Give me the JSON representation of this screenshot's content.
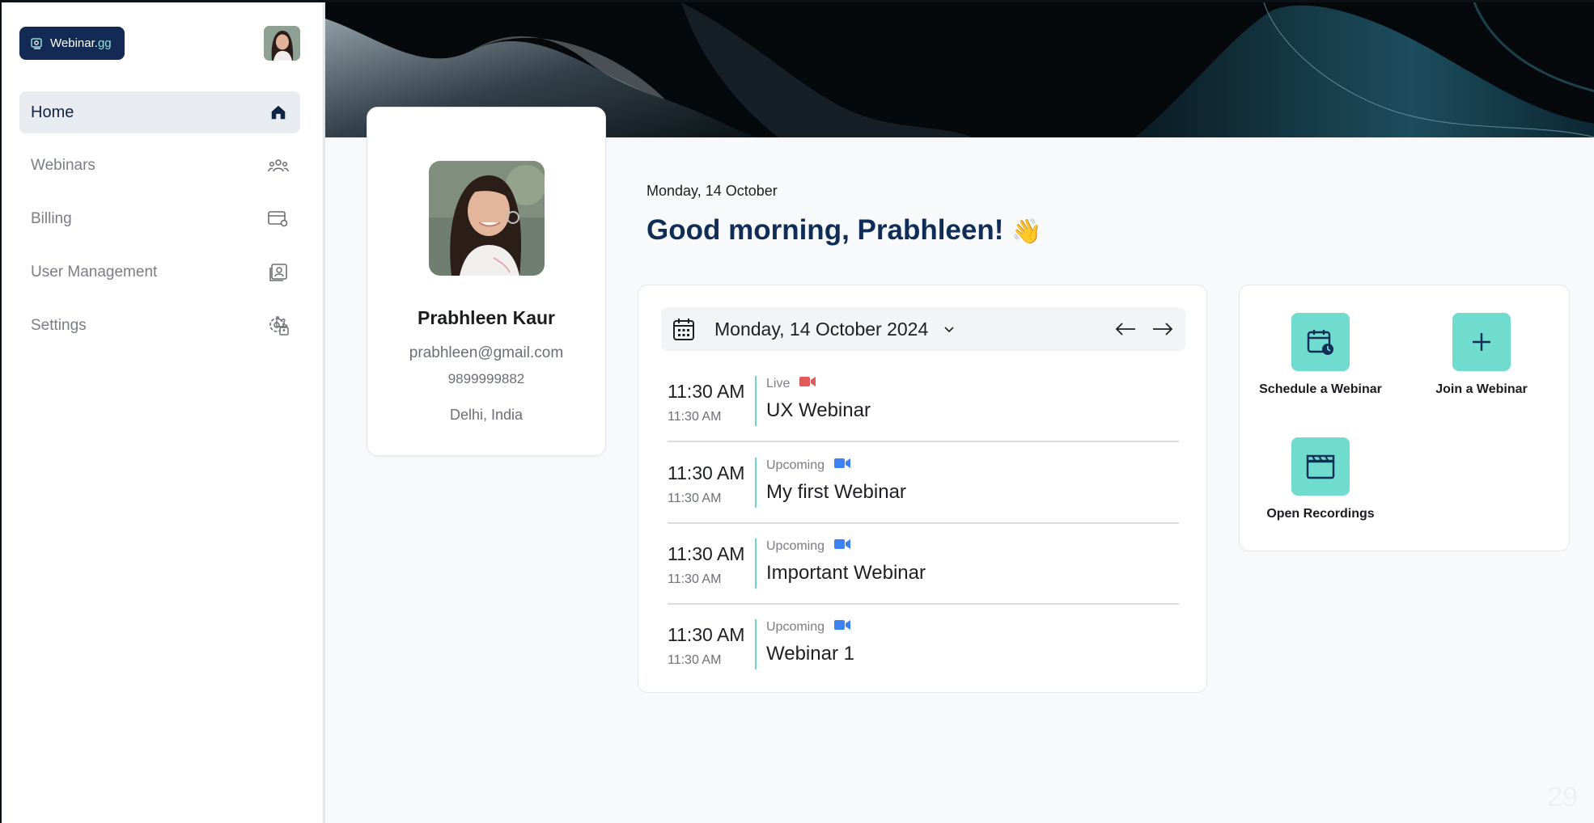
{
  "app": {
    "logo_text": "Webinar.",
    "logo_suffix": "gg"
  },
  "sidebar": {
    "items": [
      {
        "label": "Home",
        "icon": "home-icon",
        "active": true
      },
      {
        "label": "Webinars",
        "icon": "users-icon"
      },
      {
        "label": "Billing",
        "icon": "card-settings-icon"
      },
      {
        "label": "User Management",
        "icon": "contact-card-icon"
      },
      {
        "label": "Settings",
        "icon": "gear-user-icon"
      }
    ]
  },
  "profile": {
    "name": "Prabhleen Kaur",
    "email": "prabhleen@gmail.com",
    "phone": "9899999882",
    "location": "Delhi, India"
  },
  "main": {
    "date": "Monday, 14 October",
    "greeting": "Good morning, Prabhleen!",
    "greeting_emoji": "👋"
  },
  "schedule": {
    "selected_date": "Monday, 14 October 2024",
    "events": [
      {
        "start": "11:30 AM",
        "end": "11:30 AM",
        "status": "Live",
        "status_color": "#e05a5a",
        "title": "UX Webinar"
      },
      {
        "start": "11:30 AM",
        "end": "11:30 AM",
        "status": "Upcoming",
        "status_color": "#3b82f6",
        "title": "My first Webinar"
      },
      {
        "start": "11:30 AM",
        "end": "11:30 AM",
        "status": "Upcoming",
        "status_color": "#3b82f6",
        "title": "Important Webinar"
      },
      {
        "start": "11:30 AM",
        "end": "11:30 AM",
        "status": "Upcoming",
        "status_color": "#3b82f6",
        "title": "Webinar 1"
      }
    ]
  },
  "quick_actions": [
    {
      "label": "Schedule a Webinar",
      "icon": "calendar-clock-icon"
    },
    {
      "label": "Join a Webinar",
      "icon": "plus-icon"
    },
    {
      "label": "Open Recordings",
      "icon": "clapperboard-icon"
    }
  ],
  "colors": {
    "brand": "#132a55",
    "accent": "#6fdccd",
    "live": "#e05a5a",
    "upcoming": "#3b82f6"
  },
  "corner_text": "29"
}
